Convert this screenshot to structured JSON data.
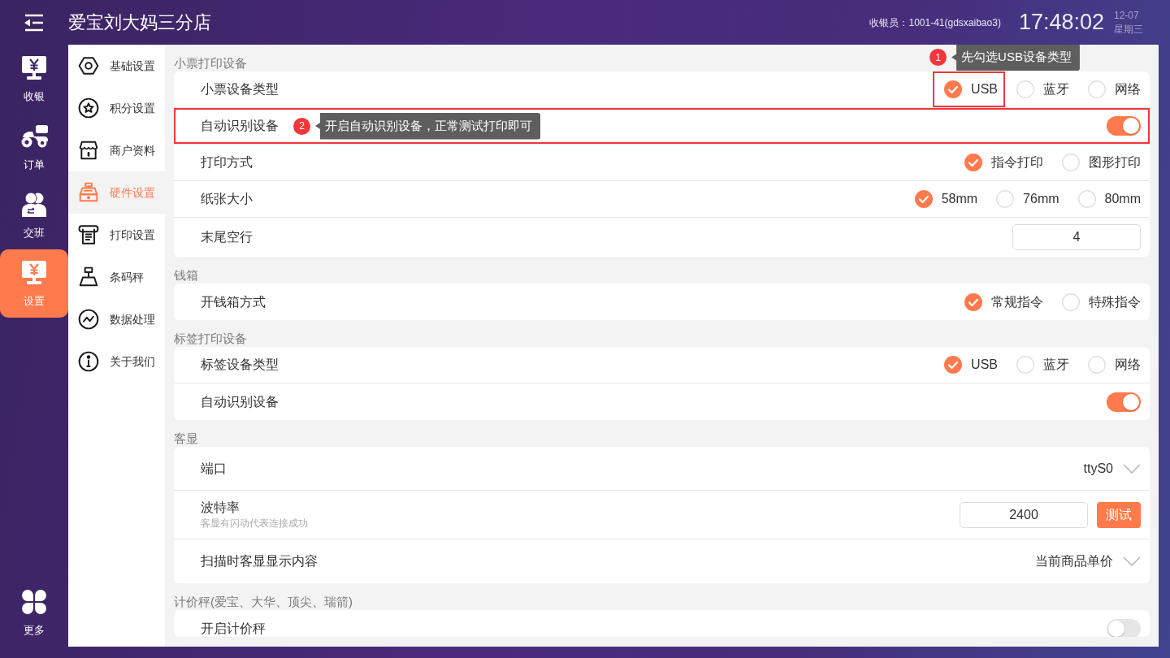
{
  "header": {
    "title": "爱宝刘大妈三分店",
    "cashier": "收银员：1001-41(gdsxaibao3)",
    "time": "17:48:02",
    "date": "12-07",
    "weekday": "星期三"
  },
  "nav": [
    {
      "kind": "cashier",
      "label": "收银",
      "selected": false
    },
    {
      "kind": "orders",
      "label": "订单",
      "selected": false
    },
    {
      "kind": "shift",
      "label": "交班",
      "selected": false
    },
    {
      "kind": "settings",
      "label": "设置",
      "selected": true
    }
  ],
  "nav_more": {
    "label": "更多"
  },
  "settings_menu": [
    {
      "kind": "basic",
      "label": "基础设置",
      "selected": false
    },
    {
      "kind": "points",
      "label": "积分设置",
      "selected": false
    },
    {
      "kind": "merchant",
      "label": "商户资料",
      "selected": false
    },
    {
      "kind": "hardware",
      "label": "硬件设置",
      "selected": true
    },
    {
      "kind": "print",
      "label": "打印设置",
      "selected": false
    },
    {
      "kind": "scale",
      "label": "条码秤",
      "selected": false
    },
    {
      "kind": "data",
      "label": "数据处理",
      "selected": false
    },
    {
      "kind": "about",
      "label": "关于我们",
      "selected": false
    }
  ],
  "sections": [
    {
      "title": "小票打印设备",
      "rows": [
        {
          "kind": "radio",
          "label": "小票设备类型",
          "highlighted": false,
          "options": [
            {
              "label": "USB",
              "selected": true,
              "highlighted": true,
              "annotation": {
                "number": "1",
                "text": "先勾选USB设备类型"
              }
            },
            {
              "label": "蓝牙",
              "selected": false,
              "highlighted": false
            },
            {
              "label": "网络",
              "selected": false,
              "highlighted": false
            }
          ]
        },
        {
          "kind": "toggle",
          "label": "自动识别设备",
          "on": true,
          "highlighted": true,
          "annotation": {
            "number": "2",
            "text": "开启自动识别设备，正常测试打印即可"
          }
        },
        {
          "kind": "radio",
          "label": "打印方式",
          "highlighted": false,
          "options": [
            {
              "label": "指令打印",
              "selected": true,
              "highlighted": false
            },
            {
              "label": "图形打印",
              "selected": false,
              "highlighted": false
            }
          ]
        },
        {
          "kind": "radio",
          "label": "纸张大小",
          "highlighted": false,
          "options": [
            {
              "label": "58mm",
              "selected": true,
              "highlighted": false
            },
            {
              "label": "76mm",
              "selected": false,
              "highlighted": false
            },
            {
              "label": "80mm",
              "selected": false,
              "highlighted": false
            }
          ]
        },
        {
          "kind": "input",
          "label": "末尾空行",
          "value": "4",
          "highlighted": false
        }
      ]
    },
    {
      "title": "钱箱",
      "rows": [
        {
          "kind": "radio",
          "label": "开钱箱方式",
          "highlighted": false,
          "options": [
            {
              "label": "常规指令",
              "selected": true,
              "highlighted": false
            },
            {
              "label": "特殊指令",
              "selected": false,
              "highlighted": false
            }
          ]
        }
      ]
    },
    {
      "title": "标签打印设备",
      "rows": [
        {
          "kind": "radio",
          "label": "标签设备类型",
          "highlighted": false,
          "options": [
            {
              "label": "USB",
              "selected": true,
              "highlighted": false
            },
            {
              "label": "蓝牙",
              "selected": false,
              "highlighted": false
            },
            {
              "label": "网络",
              "selected": false,
              "highlighted": false
            }
          ]
        },
        {
          "kind": "toggle",
          "label": "自动识别设备",
          "on": true,
          "highlighted": false
        }
      ]
    },
    {
      "title": "客显",
      "rows": [
        {
          "kind": "select",
          "label": "端口",
          "value": "ttyS0",
          "highlighted": false
        },
        {
          "kind": "input_action",
          "label": "波特率",
          "description": "客显有闪动代表连接成功",
          "value": "2400",
          "button": "测试",
          "highlighted": false
        },
        {
          "kind": "select",
          "label": "扫描时客显显示内容",
          "value": "当前商品单价",
          "highlighted": false
        }
      ]
    },
    {
      "title": "计价秤(爱宝、大华、顶尖、瑞箭)",
      "rows": [
        {
          "kind": "toggle",
          "label": "开启计价秤",
          "on": false,
          "highlighted": false
        }
      ]
    }
  ]
}
